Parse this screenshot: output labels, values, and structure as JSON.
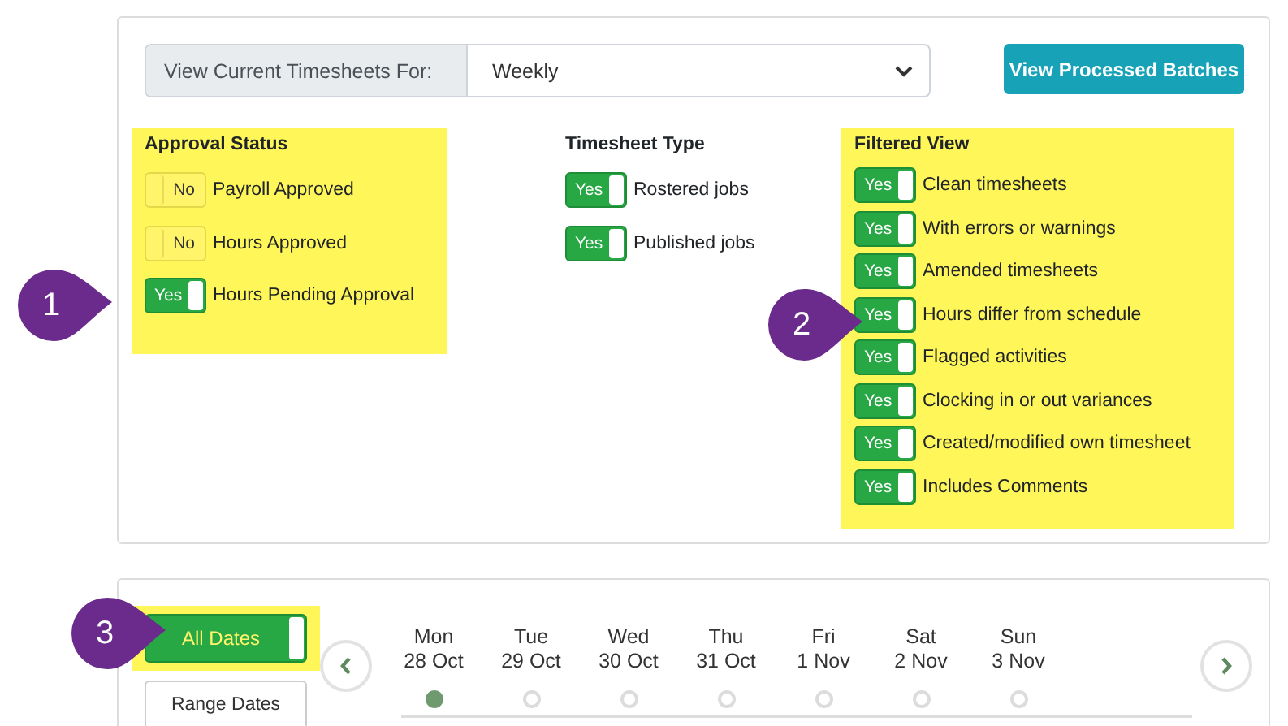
{
  "view_selector": {
    "label": "View Current Timesheets For:",
    "value": "Weekly"
  },
  "processed_button": "View Processed Batches",
  "groups": [
    {
      "title": "Approval Status",
      "highlighted": true,
      "items": [
        {
          "label": "Payroll Approved",
          "on": false,
          "toggle_text": "No"
        },
        {
          "label": "Hours Approved",
          "on": false,
          "toggle_text": "No"
        },
        {
          "label": "Hours Pending Approval",
          "on": true,
          "toggle_text": "Yes"
        }
      ]
    },
    {
      "title": "Timesheet Type",
      "highlighted": false,
      "items": [
        {
          "label": "Rostered jobs",
          "on": true,
          "toggle_text": "Yes"
        },
        {
          "label": "Published jobs",
          "on": true,
          "toggle_text": "Yes"
        }
      ]
    },
    {
      "title": "Filtered View",
      "highlighted": true,
      "items": [
        {
          "label": "Clean timesheets",
          "on": true,
          "toggle_text": "Yes"
        },
        {
          "label": "With errors or warnings",
          "on": true,
          "toggle_text": "Yes"
        },
        {
          "label": "Amended timesheets",
          "on": true,
          "toggle_text": "Yes"
        },
        {
          "label": "Hours differ from schedule",
          "on": true,
          "toggle_text": "Yes"
        },
        {
          "label": "Flagged activities",
          "on": true,
          "toggle_text": "Yes"
        },
        {
          "label": "Clocking in or out variances",
          "on": true,
          "toggle_text": "Yes"
        },
        {
          "label": "Created/modified own timesheet",
          "on": true,
          "toggle_text": "Yes"
        },
        {
          "label": "Includes Comments",
          "on": true,
          "toggle_text": "Yes"
        }
      ]
    }
  ],
  "dates": {
    "all_dates": {
      "label": "All Dates",
      "on": true,
      "highlighted": true
    },
    "range_button": "Range Dates",
    "days": [
      {
        "weekday": "Mon",
        "date": "28 Oct",
        "selected": true
      },
      {
        "weekday": "Tue",
        "date": "29 Oct",
        "selected": false
      },
      {
        "weekday": "Wed",
        "date": "30 Oct",
        "selected": false
      },
      {
        "weekday": "Thu",
        "date": "31 Oct",
        "selected": false
      },
      {
        "weekday": "Fri",
        "date": "1 Nov",
        "selected": false
      },
      {
        "weekday": "Sat",
        "date": "2 Nov",
        "selected": false
      },
      {
        "weekday": "Sun",
        "date": "3 Nov",
        "selected": false
      }
    ]
  },
  "callouts": [
    {
      "number": "1"
    },
    {
      "number": "2"
    },
    {
      "number": "3"
    }
  ]
}
